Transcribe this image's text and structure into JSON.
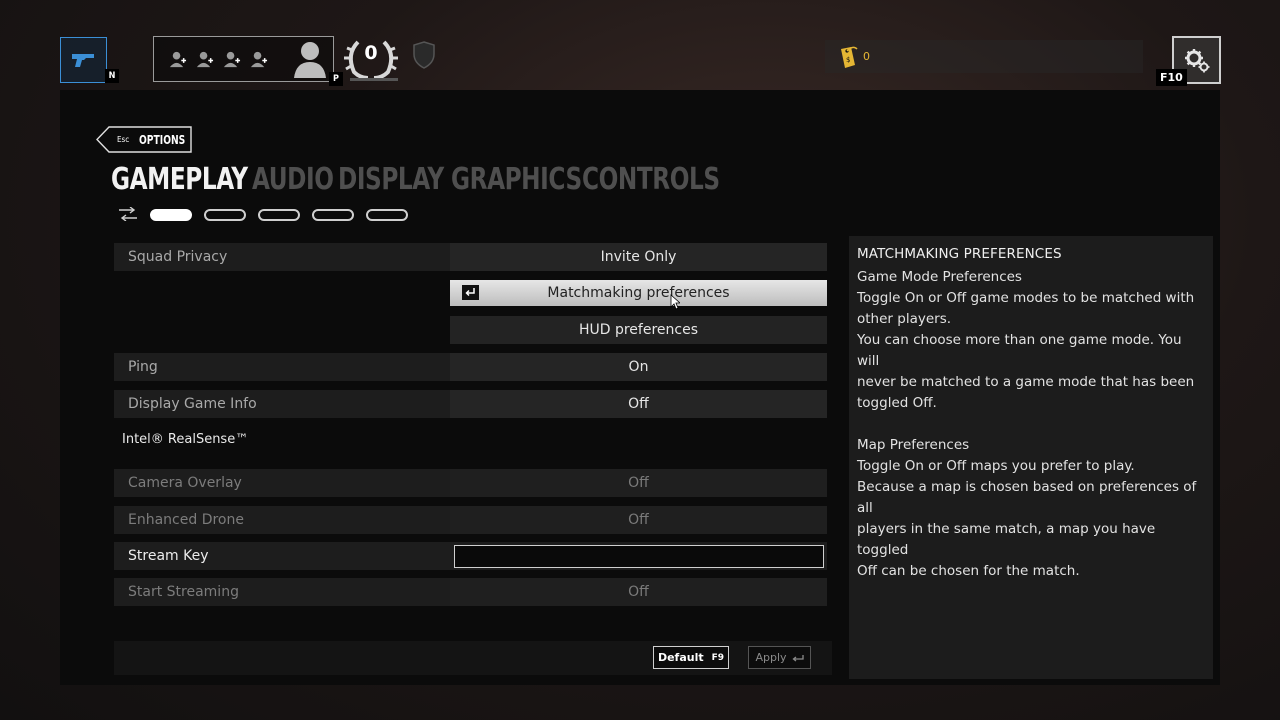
{
  "hud": {
    "weapon_key": "N",
    "profile_key": "P",
    "rank_value": "0",
    "currency_value": "0",
    "settings_key": "F10",
    "icons": {
      "weapon": "pistol-icon",
      "squad": "add-player-icon",
      "avatar": "player-avatar-icon",
      "rank": "laurel-icon",
      "shield": "shield-icon",
      "currency": "renown-tag-icon",
      "settings": "gears-icon"
    }
  },
  "back": {
    "key": "Esc",
    "label": "OPTIONS"
  },
  "tabs": [
    {
      "label": "GAMEPLAY",
      "active": true
    },
    {
      "label": "AUDIO",
      "active": false
    },
    {
      "label": "DISPLAY",
      "active": false
    },
    {
      "label": "GRAPHICS",
      "active": false
    },
    {
      "label": "CONTROLS",
      "active": false
    }
  ],
  "pager": {
    "pages": 5,
    "active_page": 1
  },
  "settings": {
    "squad_privacy": {
      "label": "Squad Privacy",
      "value": "Invite Only"
    },
    "matchmaking_button": "Matchmaking preferences",
    "hud_button": "HUD preferences",
    "ping": {
      "label": "Ping",
      "value": "On"
    },
    "game_info": {
      "label": "Display Game Info",
      "value": "Off"
    },
    "realsense_header": "Intel® RealSense™",
    "camera_overlay": {
      "label": "Camera Overlay",
      "value": "Off"
    },
    "enhanced_drone": {
      "label": "Enhanced Drone",
      "value": "Off"
    },
    "stream_key": {
      "label": "Stream Key",
      "value": ""
    },
    "start_streaming": {
      "label": "Start Streaming",
      "value": "Off"
    }
  },
  "footer": {
    "default_label": "Default",
    "default_key": "F9",
    "apply_label": "Apply"
  },
  "info": {
    "title": "MATCHMAKING PREFERENCES",
    "section1_title": "Game Mode Preferences",
    "section1_lines": [
      "Toggle On or Off game modes to be matched with",
      "other players.",
      "You can choose more than one game mode. You will",
      "never be matched to a game mode that has been",
      "toggled Off."
    ],
    "section2_title": "Map Preferences",
    "section2_lines": [
      "Toggle On or Off maps you prefer to play.",
      "Because a map is chosen based on preferences of all",
      "players in the same match, a map you have toggled",
      "Off can be chosen for the match."
    ]
  },
  "colors": {
    "accent_blue": "#3b8fd6",
    "currency_gold": "#e5b634",
    "panel_bg": "#0b0b0b",
    "row_bg": "#1d1d1d",
    "active_tab": "#f2f2f2",
    "inactive_tab": "#4f4f4f"
  }
}
